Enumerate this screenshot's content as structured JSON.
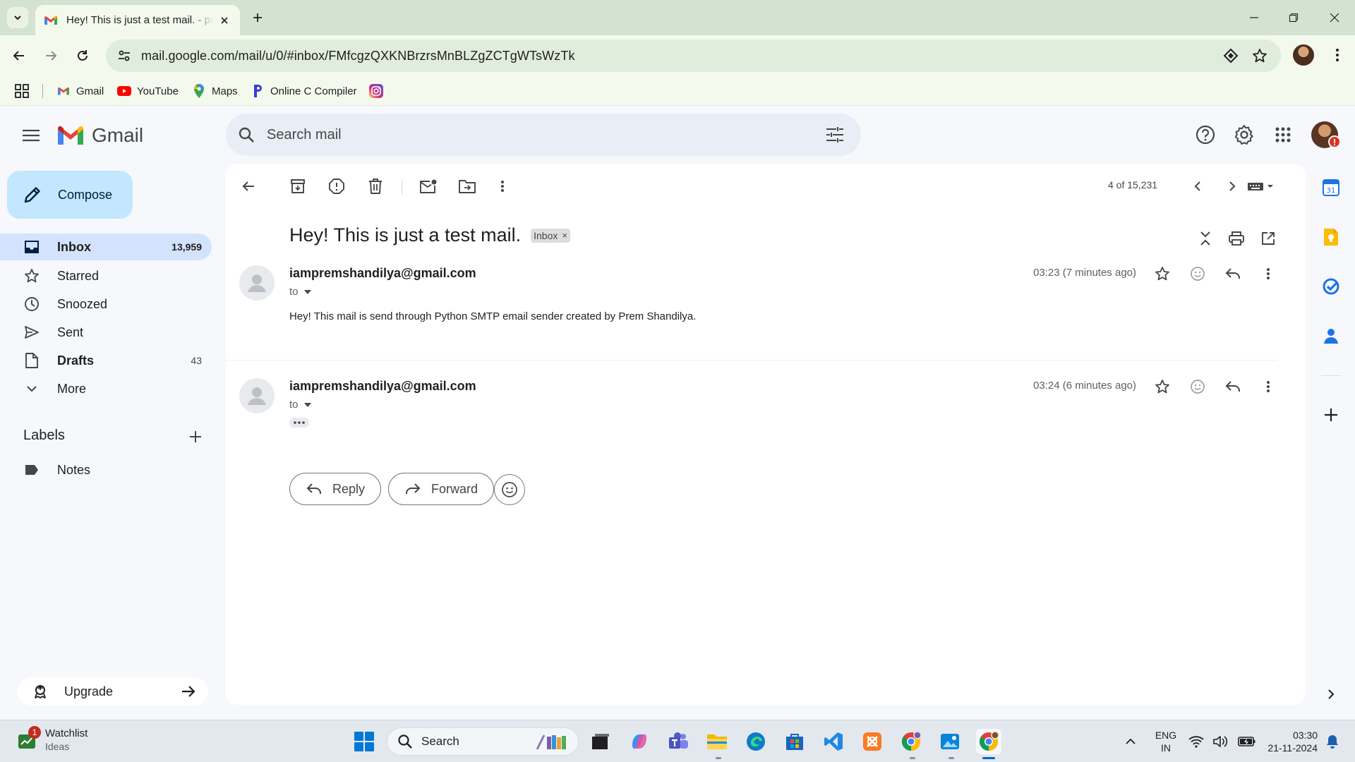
{
  "browser": {
    "tab_title": "Hey! This is just a test mail. - pr",
    "url": "mail.google.com/mail/u/0/#inbox/FMfcgzQXKNBrzrsMnBLZgZCTgWTsWzTk",
    "bookmarks": [
      {
        "label": "Gmail",
        "icon": "gmail-icon"
      },
      {
        "label": "YouTube",
        "icon": "youtube-icon"
      },
      {
        "label": "Maps",
        "icon": "maps-icon"
      },
      {
        "label": "Online C Compiler",
        "icon": "programiz-icon"
      },
      {
        "label": "",
        "icon": "instagram-icon"
      }
    ]
  },
  "gmail": {
    "wordmark": "Gmail",
    "search_placeholder": "Search mail",
    "compose_label": "Compose",
    "nav": [
      {
        "label": "Inbox",
        "count": "13,959",
        "icon": "inbox-icon",
        "active": true,
        "bold": true
      },
      {
        "label": "Starred",
        "count": "",
        "icon": "star-icon"
      },
      {
        "label": "Snoozed",
        "count": "",
        "icon": "clock-icon"
      },
      {
        "label": "Sent",
        "count": "",
        "icon": "send-icon"
      },
      {
        "label": "Drafts",
        "count": "43",
        "icon": "draft-icon",
        "bold": true
      },
      {
        "label": "More",
        "count": "",
        "icon": "chevron-down-icon"
      }
    ],
    "labels_title": "Labels",
    "labels": [
      {
        "label": "Notes",
        "icon": "label-icon"
      }
    ],
    "upgrade_label": "Upgrade"
  },
  "thread": {
    "pager": "4 of 15,231",
    "subject": "Hey! This is just a test mail.",
    "chip": "Inbox",
    "messages": [
      {
        "from": "iampremshandilya@gmail.com",
        "to": "to",
        "time": "03:23 (7 minutes ago)",
        "body": "Hey! This mail is send through Python SMTP email sender created by Prem Shandilya."
      },
      {
        "from": "iampremshandilya@gmail.com",
        "to": "to",
        "time": "03:24 (6 minutes ago)",
        "body": ""
      }
    ],
    "reply_label": "Reply",
    "forward_label": "Forward"
  },
  "taskbar": {
    "widget_title": "Watchlist",
    "widget_subtitle": "Ideas",
    "widget_badge": "1",
    "search_label": "Search",
    "lang_line1": "ENG",
    "lang_line2": "IN",
    "time": "03:30",
    "date": "21-11-2024"
  },
  "colors": {
    "accent": "#0b57d0",
    "compose_bg": "#c2e7ff",
    "active_nav_bg": "#d3e3fd",
    "gmail_red": "#ea4335"
  }
}
